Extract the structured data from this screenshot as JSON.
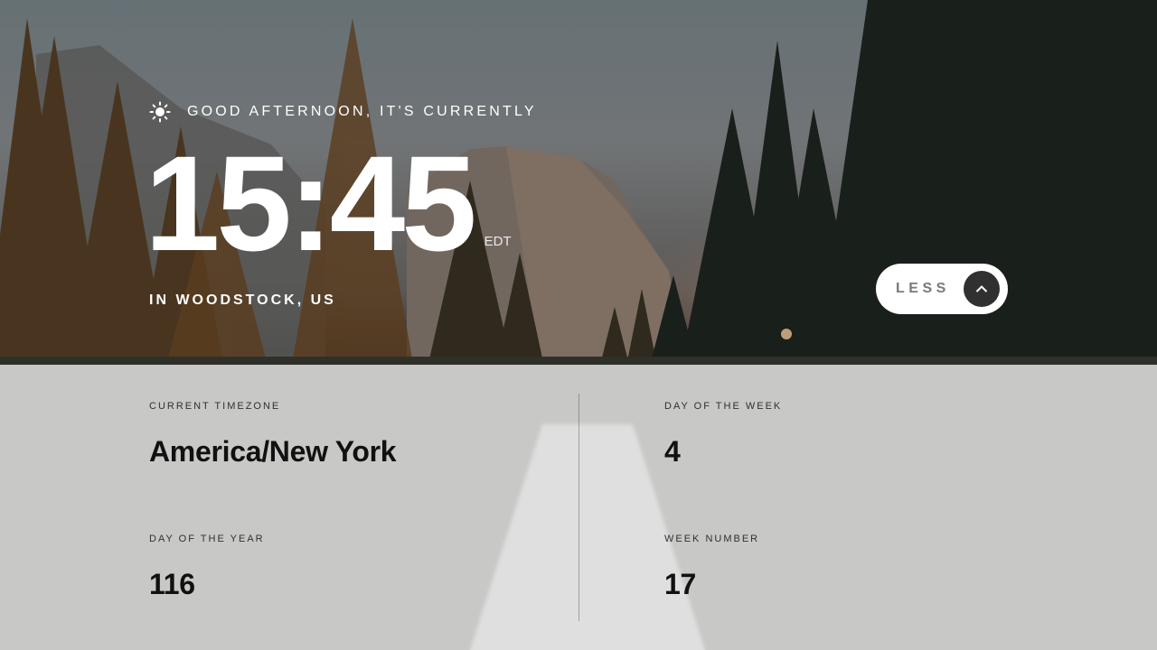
{
  "greeting": {
    "icon": "sun-icon",
    "text": "GOOD AFTERNOON, IT'S CURRENTLY"
  },
  "clock": {
    "time": "15:45",
    "abbreviation": "EDT",
    "location": "IN WOODSTOCK, US"
  },
  "toggle": {
    "label": "LESS",
    "icon": "chevron-up-icon"
  },
  "details": {
    "timezone": {
      "label": "CURRENT TIMEZONE",
      "value": "America/New York"
    },
    "day_of_week": {
      "label": "DAY OF THE WEEK",
      "value": "4"
    },
    "day_of_year": {
      "label": "DAY OF THE YEAR",
      "value": "116"
    },
    "week_number": {
      "label": "WEEK NUMBER",
      "value": "17"
    }
  },
  "colors": {
    "text_light": "#FFFFFF",
    "text_dark": "#303030",
    "button_bg": "#FFFFFF",
    "button_circle": "#303030",
    "panel_overlay": "rgba(255,255,255,0.72)"
  }
}
